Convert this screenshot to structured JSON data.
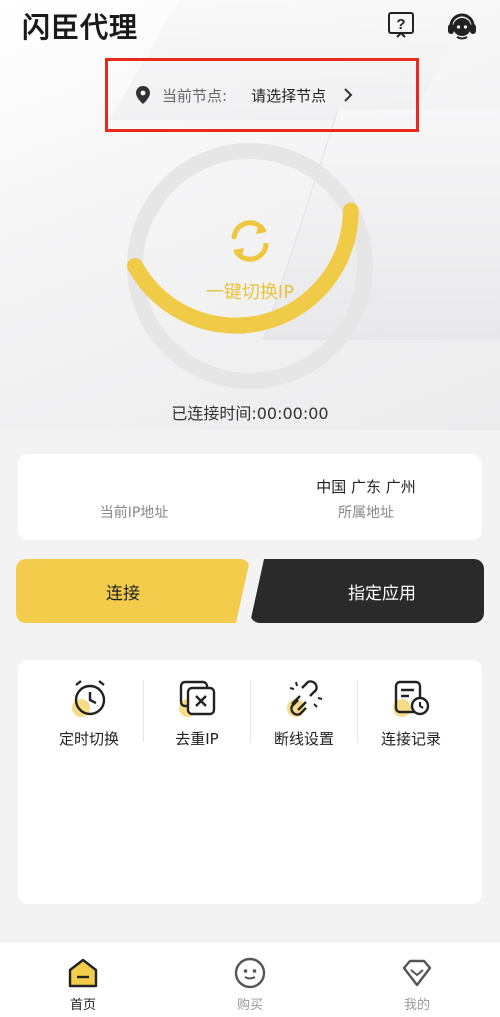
{
  "header": {
    "title": "闪臣代理",
    "help_icon": "question-doc-icon",
    "service_icon": "customer-service-icon"
  },
  "node": {
    "pin_icon": "location-pin-icon",
    "label": "当前节点:",
    "value": "请选择节点",
    "arrow_icon": "chevron-right-icon"
  },
  "switch": {
    "label": "一键切换IP",
    "icon": "refresh-icon",
    "ring_progress": 0.42
  },
  "connection": {
    "time_text": "已连接时间:00:00:00"
  },
  "ip_info": {
    "current_ip_value": "",
    "current_ip_caption": "当前IP地址",
    "location_value": "中国 广东 广州",
    "location_caption": "所属地址"
  },
  "actions": {
    "connect_label": "连接",
    "app_label": "指定应用"
  },
  "tools": [
    {
      "label": "定时切换",
      "icon": "alarm-clock-icon"
    },
    {
      "label": "去重IP",
      "icon": "dedupe-icon"
    },
    {
      "label": "断线设置",
      "icon": "broken-link-icon"
    },
    {
      "label": "连接记录",
      "icon": "record-icon"
    }
  ],
  "tabbar": {
    "home": "首页",
    "buy": "购买",
    "mine": "我的"
  },
  "colors": {
    "accent": "#F2CC4A",
    "dark": "#2A2A2A",
    "highlight_border": "#E8291C"
  }
}
